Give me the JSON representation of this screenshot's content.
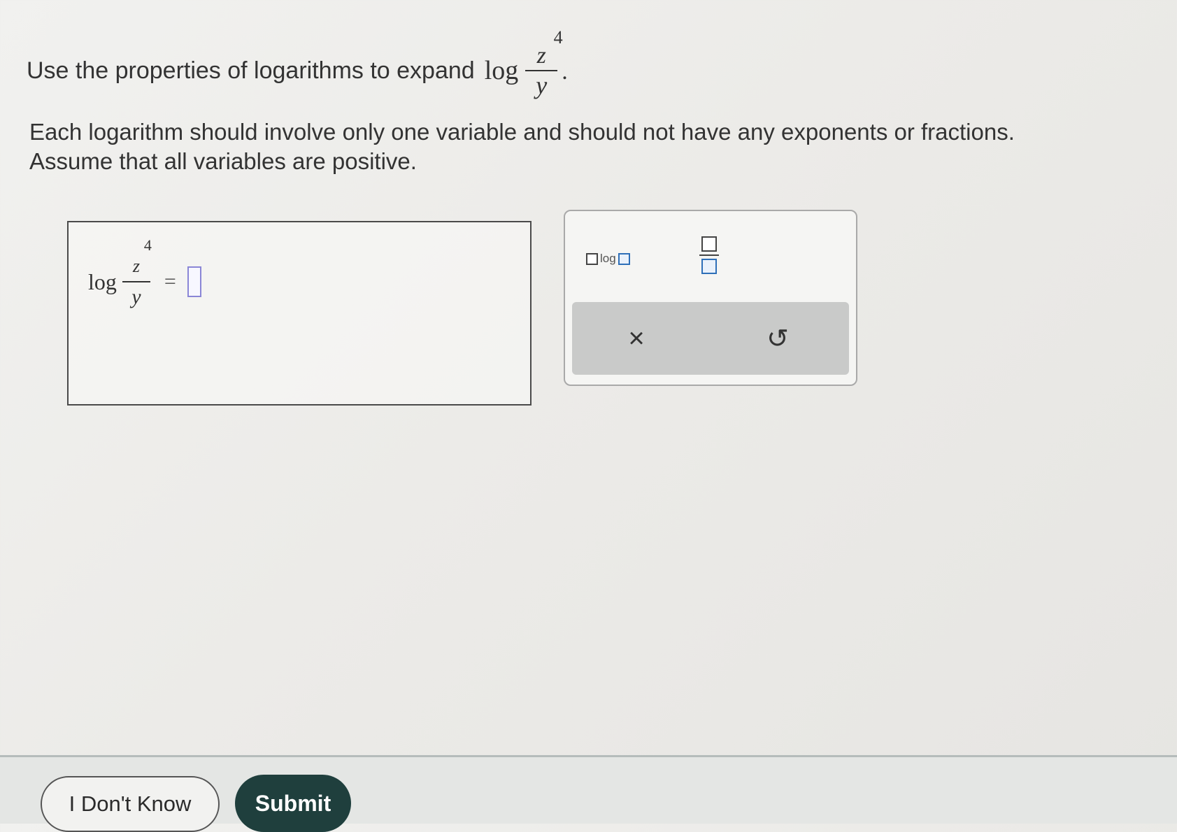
{
  "question": {
    "prefix": "Use the properties of logarithms to expand",
    "log_word": "log",
    "numerator_var": "z",
    "exponent": "4",
    "denominator_var": "y",
    "period": "."
  },
  "instructions": {
    "line1": "Each logarithm should involve only one variable and should not have any exponents or fractions.",
    "line2": "Assume that all variables are positive."
  },
  "answer": {
    "log_word": "log",
    "numerator_var": "z",
    "exponent": "4",
    "denominator_var": "y",
    "equals": "="
  },
  "keypad": {
    "log_key_label": "log",
    "clear_glyph": "×",
    "undo_glyph": "↺"
  },
  "actions": {
    "dont_know_label": "I Don't Know",
    "submit_label": "Submit"
  }
}
